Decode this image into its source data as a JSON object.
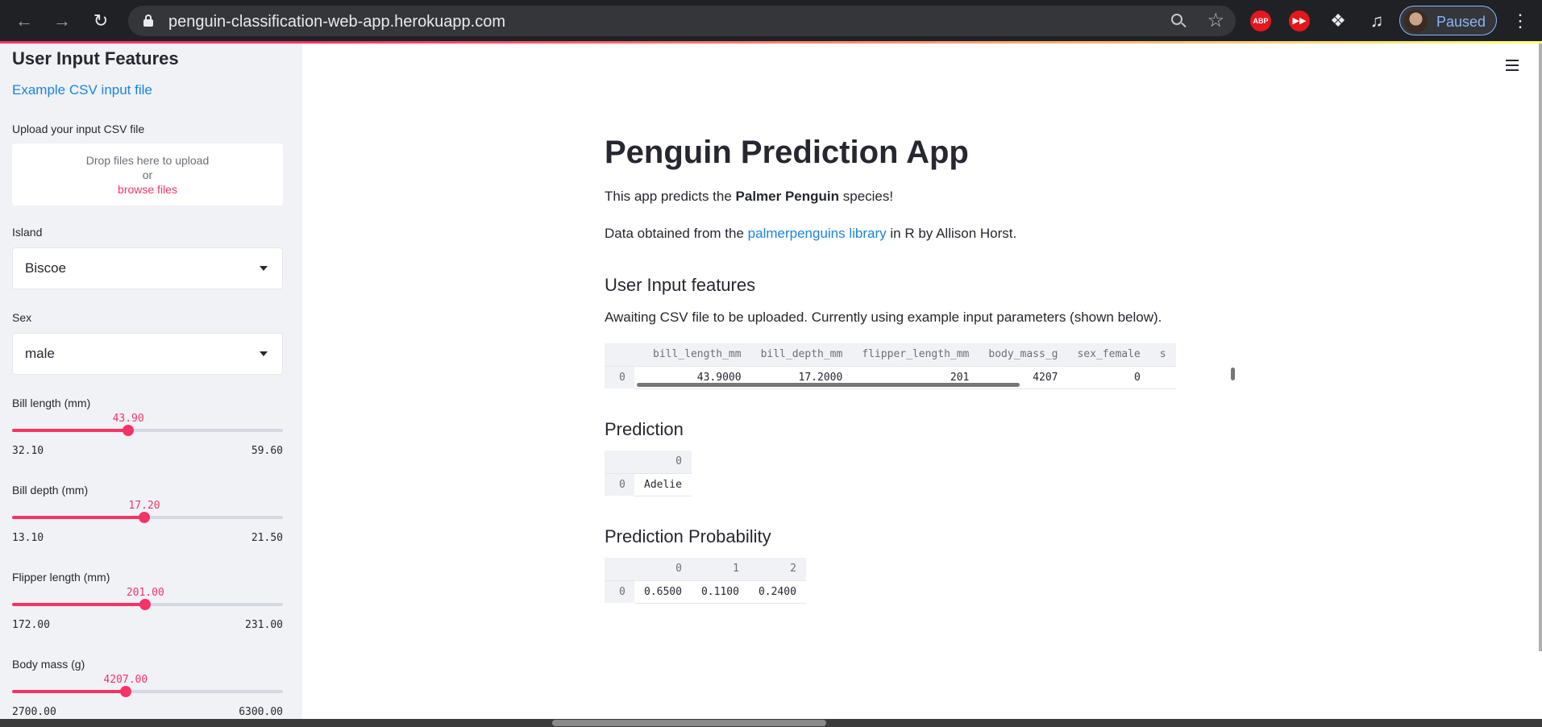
{
  "browser": {
    "url": "penguin-classification-web-app.herokuapp.com",
    "profile_status": "Paused",
    "extensions": [
      "ABP",
      "▶▶"
    ]
  },
  "sidebar": {
    "header": "User Input Features",
    "example_link": "Example CSV input file",
    "upload_label": "Upload your input CSV file",
    "uploader": {
      "drop_text": "Drop files here to upload",
      "or_text": "or",
      "browse_text": "browse files"
    },
    "island": {
      "label": "Island",
      "value": "Biscoe"
    },
    "sex": {
      "label": "Sex",
      "value": "male"
    },
    "sliders": [
      {
        "label": "Bill length (mm)",
        "value": "43.90",
        "min": "32.10",
        "max": "59.60",
        "fraction": 0.429
      },
      {
        "label": "Bill depth (mm)",
        "value": "17.20",
        "min": "13.10",
        "max": "21.50",
        "fraction": 0.488
      },
      {
        "label": "Flipper length (mm)",
        "value": "201.00",
        "min": "172.00",
        "max": "231.00",
        "fraction": 0.492
      },
      {
        "label": "Body mass (g)",
        "value": "4207.00",
        "min": "2700.00",
        "max": "6300.00",
        "fraction": 0.419
      }
    ]
  },
  "main": {
    "title": "Penguin Prediction App",
    "intro_pre": "This app predicts the ",
    "intro_bold": "Palmer Penguin",
    "intro_post": " species!",
    "data_pre": "Data obtained from the ",
    "data_link": "palmerpenguins library",
    "data_post": " in R by Allison Horst.",
    "input_header": "User Input features",
    "awaiting_text": "Awaiting CSV file to be uploaded. Currently using example input parameters (shown below).",
    "input_table": {
      "columns": [
        "bill_length_mm",
        "bill_depth_mm",
        "flipper_length_mm",
        "body_mass_g",
        "sex_female",
        "s"
      ],
      "rows": [
        {
          "index": "0",
          "cells": [
            "43.9000",
            "17.2000",
            "201",
            "4207",
            "0",
            ""
          ]
        }
      ]
    },
    "prediction_header": "Prediction",
    "prediction_table": {
      "columns": [
        "0"
      ],
      "rows": [
        {
          "index": "0",
          "cells": [
            "Adelie"
          ]
        }
      ]
    },
    "probability_header": "Prediction Probability",
    "probability_table": {
      "columns": [
        "0",
        "1",
        "2"
      ],
      "rows": [
        {
          "index": "0",
          "cells": [
            "0.6500",
            "0.1100",
            "0.2400"
          ]
        }
      ]
    }
  }
}
